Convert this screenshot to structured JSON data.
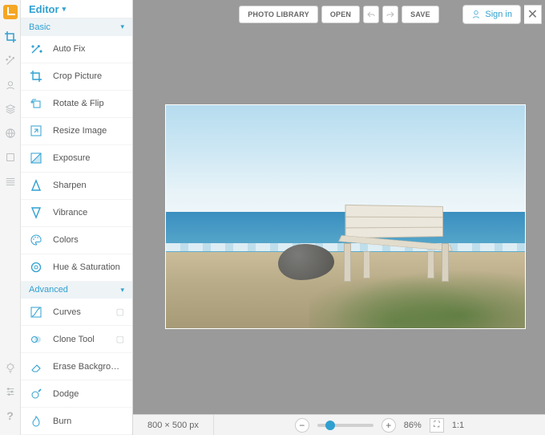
{
  "accent_color": "#2fa0d0",
  "header": {
    "title": "Editor"
  },
  "sections": {
    "basic": "Basic",
    "advanced": "Advanced"
  },
  "tools_basic": [
    {
      "label": "Auto Fix"
    },
    {
      "label": "Crop Picture"
    },
    {
      "label": "Rotate & Flip"
    },
    {
      "label": "Resize Image"
    },
    {
      "label": "Exposure"
    },
    {
      "label": "Sharpen"
    },
    {
      "label": "Vibrance"
    },
    {
      "label": "Colors"
    },
    {
      "label": "Hue & Saturation"
    }
  ],
  "tools_advanced": [
    {
      "label": "Curves"
    },
    {
      "label": "Clone Tool"
    },
    {
      "label": "Erase Background"
    },
    {
      "label": "Dodge"
    },
    {
      "label": "Burn"
    }
  ],
  "topbar": {
    "photo_library": "PHOTO LIBRARY",
    "open": "OPEN",
    "save": "SAVE",
    "sign_in": "Sign in"
  },
  "status": {
    "dimensions": "800 × 500 px",
    "zoom_pct": "86%",
    "ratio": "1:1"
  },
  "canvas": {
    "description": "White wooden bench on sandy grass-dotted shore facing calm blue sea under pale sky; gray rock to the left"
  }
}
